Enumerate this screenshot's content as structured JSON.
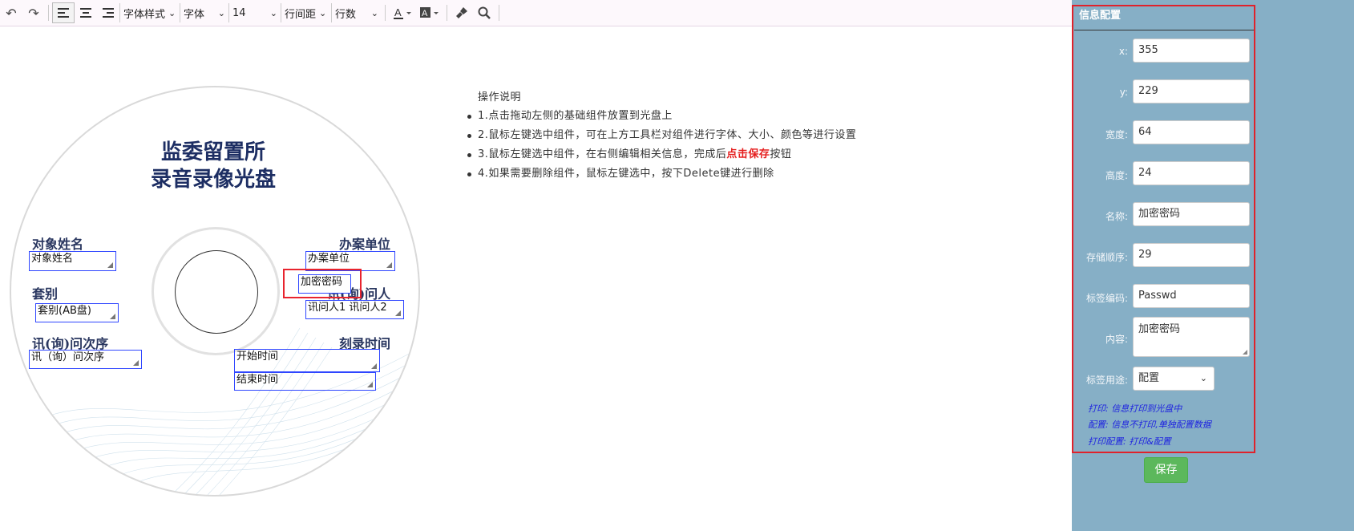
{
  "toolbar": {
    "font_style": "字体样式",
    "font": "字体",
    "size": "14",
    "line_spacing": "行间距",
    "lines": "行数"
  },
  "disc": {
    "title_line1": "监委留置所",
    "title_line2": "录音录像光盘",
    "labels": {
      "subject_name": "对象姓名",
      "case_unit": "办案单位",
      "set": "套别",
      "interrogator": "讯(询)问人",
      "interrogation_order": "讯(询)问次序",
      "burn_time": "刻录时间"
    },
    "fields": {
      "subject_name": "对象姓名",
      "case_unit": "办案单位",
      "password": "加密密码",
      "set": "套别(AB盘)",
      "interrogators": "讯问人1 讯问人2",
      "interrogation_order": "讯（询）问次序",
      "start_time": "开始时间",
      "end_time": "结束时间"
    }
  },
  "help": {
    "title": "操作说明",
    "items": [
      "1.点击拖动左侧的基础组件放置到光盘上",
      "2.鼠标左键选中组件，可在上方工具栏对组件进行字体、大小、颜色等进行设置"
    ],
    "item3_prefix": "3.鼠标左键选中组件，在右侧编辑相关信息，完成后",
    "item3_highlight": "点击保存",
    "item3_suffix": "按钮",
    "item4": "4.如果需要删除组件，鼠标左键选中，按下Delete键进行删除"
  },
  "panel": {
    "title": "信息配置",
    "x_label": "x:",
    "x_value": "355",
    "y_label": "y:",
    "y_value": "229",
    "width_label": "宽度:",
    "width_value": "64",
    "height_label": "高度:",
    "height_value": "24",
    "name_label": "名称:",
    "name_value": "加密密码",
    "order_label": "存储顺序:",
    "order_value": "29",
    "code_label": "标签编码:",
    "code_value": "Passwd",
    "content_label": "内容:",
    "content_value": "加密密码",
    "usage_label": "标签用途:",
    "usage_value": "配置",
    "legend1": "打印: 信息打印到光盘中",
    "legend2": "配置: 信息不打印,单独配置数据",
    "legend3": "打印配置: 打印&配置",
    "save": "保存"
  }
}
